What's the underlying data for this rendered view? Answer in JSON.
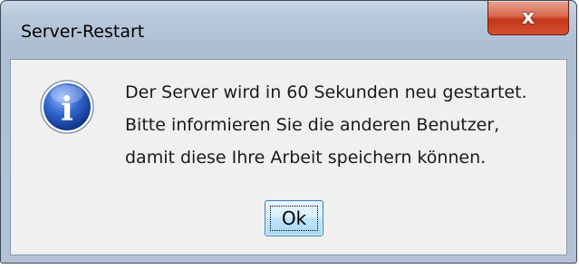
{
  "window": {
    "title": "Server-Restart",
    "close_icon": "close-icon",
    "close_glyph": "x"
  },
  "dialog": {
    "icon": "info-icon",
    "icon_glyph": "i",
    "message_lines": [
      "Der Server wird in 60 Sekunden neu gestartet.",
      "Bitte informieren Sie die anderen Benutzer,",
      "damit diese Ihre Arbeit speichern können."
    ],
    "ok_label": "Ok"
  },
  "colors": {
    "close_button": "#c3361a",
    "info_icon": "#2f63c9",
    "ok_button_border": "#3c7fb1"
  }
}
